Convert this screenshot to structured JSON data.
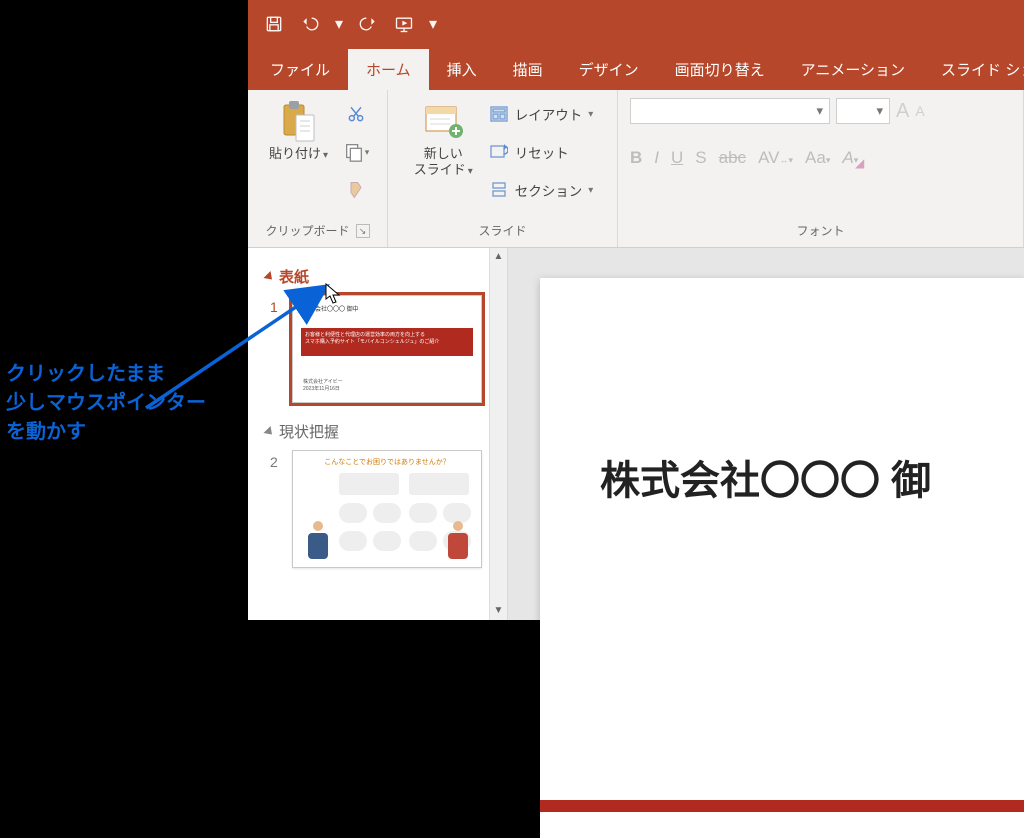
{
  "qat": {
    "save": "save",
    "undo": "undo",
    "redo": "redo",
    "slideshow": "slideshow"
  },
  "tabs": {
    "file": "ファイル",
    "home": "ホーム",
    "insert": "挿入",
    "draw": "描画",
    "design": "デザイン",
    "transitions": "画面切り替え",
    "animations": "アニメーション",
    "slideshow": "スライド ショー"
  },
  "ribbon": {
    "clipboard": {
      "paste": "貼り付け",
      "label": "クリップボード"
    },
    "slides": {
      "newslide": "新しい\nスライド",
      "layout": "レイアウト",
      "reset": "リセット",
      "section": "セクション",
      "label": "スライド"
    },
    "font": {
      "label": "フォント"
    }
  },
  "outline": {
    "section1": "表紙",
    "section2": "現状把握",
    "slide1_small": "株式会社〇〇〇 御中",
    "slide1_bar1": "お客様と利便性と代理店の運営効率の両方を向上する",
    "slide1_bar2": "スマホ購入予約サイト「モバイルコンシェルジュ」のご紹介",
    "slide1_foot": "株式会社アイビー\n2023年11月16日",
    "slide2_title": "こんなことでお困りではありませんか？"
  },
  "canvas": {
    "title": "株式会社〇〇〇 御"
  },
  "annotation": "クリックしたまま\n少しマウスポインター\nを動かす"
}
